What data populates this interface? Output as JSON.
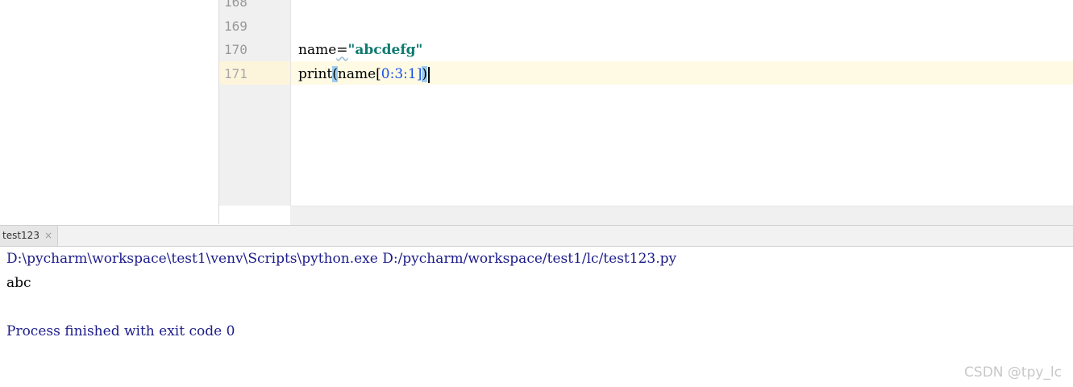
{
  "editor": {
    "gutter_lines": [
      "168",
      "169",
      "170",
      "171"
    ],
    "code": {
      "line170": {
        "ident": "name",
        "op": "=",
        "string": "\"abcdefg\""
      },
      "line171": {
        "func": "print",
        "lparen": "(",
        "ident": "name",
        "lbracket": "[",
        "n0": "0",
        "c1": ":",
        "n3": "3",
        "c2": ":",
        "n1": "1",
        "rbracket": "]",
        "rparen": ")"
      }
    }
  },
  "run_panel": {
    "tab_label": "test123",
    "tab_close": "×"
  },
  "console": {
    "command": "D:\\pycharm\\workspace\\test1\\venv\\Scripts\\python.exe D:/pycharm/workspace/test1/lc/test123.py",
    "output": "abc",
    "exit_message": "Process finished with exit code 0"
  },
  "watermark": "CSDN @tpy_lc",
  "colors": {
    "string": "#0f7a70",
    "number": "#1750eb",
    "current_line": "#fffae3",
    "brace_highlight": "#9fcdf0",
    "console_text": "#1c1c8a"
  }
}
